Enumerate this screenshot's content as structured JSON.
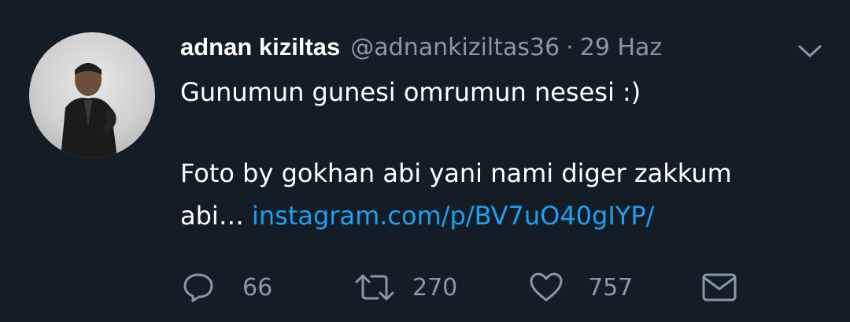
{
  "tweet": {
    "author_name": "adnan kiziltas",
    "handle": "@adnankiziltas36",
    "separator": "·",
    "date": "29 Haz",
    "text_line1": "Gunumun gunesi omrumun nesesi :)",
    "text_line2": "Foto by gokhan abi yani nami diger zakkum",
    "text_line3_prefix": "abi… ",
    "link_text": "instagram.com/p/BV7uO40gIYP/"
  },
  "actions": {
    "reply_count": "66",
    "retweet_count": "270",
    "like_count": "757"
  },
  "colors": {
    "background": "#141d26",
    "secondary_text": "#8899a6",
    "link": "#1da1f2"
  },
  "icons": [
    "avatar-photo",
    "chevron-down-icon",
    "reply-icon",
    "retweet-icon",
    "like-icon",
    "message-icon"
  ]
}
